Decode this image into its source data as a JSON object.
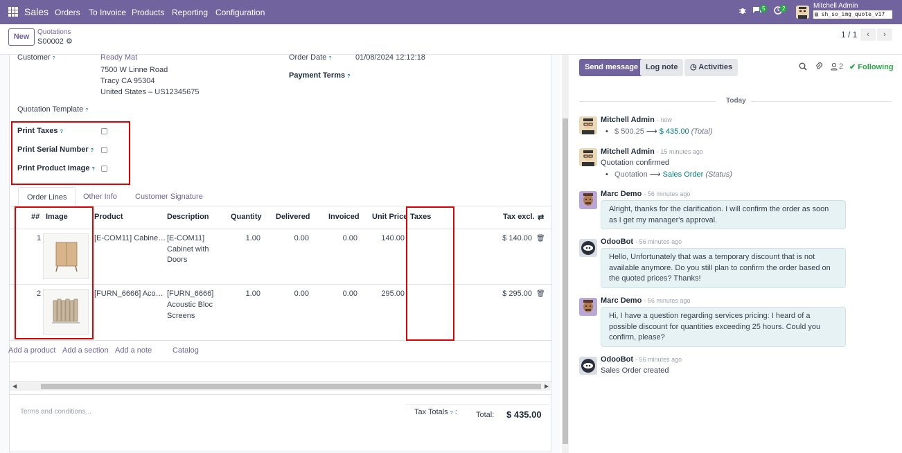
{
  "navbar": {
    "brand": "Sales",
    "menu": [
      "Orders",
      "To Invoice",
      "Products",
      "Reporting",
      "Configuration"
    ],
    "messages_count": "5",
    "activities_count": "2",
    "user_name": "Mitchell Admin",
    "database": "sh_so_img_quote_v17"
  },
  "control_panel": {
    "new_label": "New",
    "breadcrumb_parent": "Quotations",
    "breadcrumb_current": "S00002",
    "pager": "1 / 1"
  },
  "form": {
    "customer_label": "Customer",
    "customer_name": "Ready Mat",
    "customer_address": [
      "7500 W Linne Road",
      "Tracy CA 95304",
      "United States – US12345675"
    ],
    "order_date_label": "Order Date",
    "order_date": "01/08/2024 12:12:18",
    "payment_terms_label": "Payment Terms",
    "template_label": "Quotation Template",
    "print_taxes_label": "Print Taxes",
    "print_serial_label": "Print Serial Number",
    "print_image_label": "Print Product Image",
    "help_mark": "?"
  },
  "tabs": [
    "Order Lines",
    "Other Info",
    "Customer Signature"
  ],
  "order_lines": {
    "headers": {
      "seq": "##",
      "image": "Image",
      "product": "Product",
      "description": "Description",
      "quantity": "Quantity",
      "delivered": "Delivered",
      "invoiced": "Invoiced",
      "unit_price": "Unit Price",
      "taxes": "Taxes",
      "tax_excl": "Tax excl."
    },
    "rows": [
      {
        "seq": "1",
        "product": "[E-COM11] Cabine…",
        "description": [
          "[E-COM11]",
          "Cabinet with",
          "Doors"
        ],
        "quantity": "1.00",
        "delivered": "0.00",
        "invoiced": "0.00",
        "unit_price": "140.00",
        "taxes": "",
        "subtotal": "$ 140.00",
        "image_icon": "cabinet-image"
      },
      {
        "seq": "2",
        "product": "[FURN_6666] Aco…",
        "description": [
          "[FURN_6666]",
          "Acoustic Bloc",
          "Screens"
        ],
        "quantity": "1.00",
        "delivered": "0.00",
        "invoiced": "0.00",
        "unit_price": "295.00",
        "taxes": "",
        "subtotal": "$ 295.00",
        "image_icon": "acoustic-screen-image"
      }
    ],
    "add_links": [
      "Add a product",
      "Add a section",
      "Add a note",
      "Catalog"
    ]
  },
  "footer": {
    "terms_placeholder": "Terms and conditions...",
    "tax_totals_label": "Tax Totals",
    "total_label": "Total:",
    "total_value": "$ 435.00"
  },
  "chatter": {
    "send_message": "Send message",
    "log_note": "Log note",
    "activities": "Activities",
    "followers_count": "2",
    "following": "Following",
    "date_separator": "Today",
    "messages": [
      {
        "author": "Mitchell Admin",
        "time": "- now",
        "tracking_old": "$ 500.25",
        "tracking_new": "$ 435.00",
        "tracking_field": "(Total)"
      },
      {
        "author": "Mitchell Admin",
        "time": "- 15 minutes ago",
        "body": "Quotation confirmed",
        "tracking_old": "Quotation",
        "tracking_new": "Sales Order",
        "tracking_field": "(Status)"
      },
      {
        "author": "Marc Demo",
        "time": "- 56 minutes ago",
        "body": "Alright, thanks for the clarification. I will confirm the order as soon as I get my manager's approval."
      },
      {
        "author": "OdooBot",
        "time": "- 56 minutes ago",
        "body": "Hello, Unfortunately that was a temporary discount that is not available anymore. Do you still plan to confirm the order based on the quoted prices? Thanks!"
      },
      {
        "author": "Marc Demo",
        "time": "- 56 minutes ago",
        "body": "Hi, I have a question regarding services pricing: I heard of a possible discount for quantities exceeding 25 hours. Could you confirm, please?"
      },
      {
        "author": "OdooBot",
        "time": "- 56 minutes ago",
        "body": "Sales Order created"
      }
    ]
  },
  "colors": {
    "brand": "#71639e",
    "highlight": "#e00000",
    "following": "#28a745",
    "link": "#017e84"
  }
}
